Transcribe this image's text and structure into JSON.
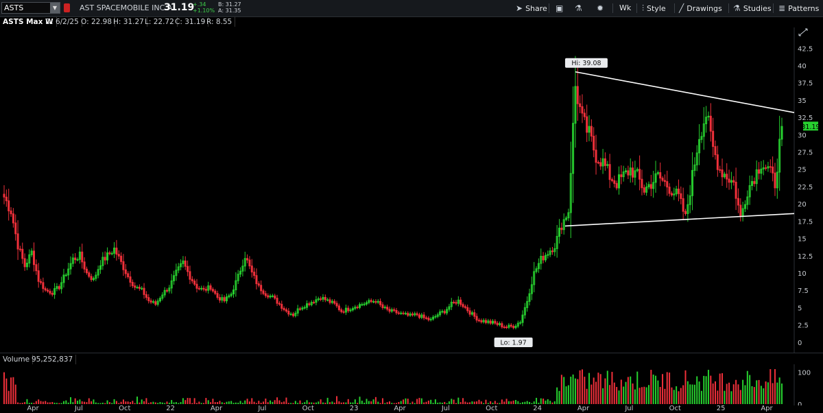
{
  "header": {
    "symbol": "ASTS",
    "company": "AST SPACEMOBILE INC A",
    "last": "31.19",
    "change": "+.34",
    "change_pct": "+1.10%",
    "bid": "B: 31.27",
    "ask": "A: 31.35"
  },
  "toolbar": {
    "share": "Share",
    "wk": "Wk",
    "style": "Style",
    "drawings": "Drawings",
    "studies": "Studies",
    "patterns": "Patterns"
  },
  "infobar": {
    "title": "ASTS Max W",
    "date": "D: 6/2/25",
    "open": "O: 22.98",
    "high": "H: 31.27",
    "low": "L: 22.72",
    "close": "C: 31.19",
    "range": "R: 8.55"
  },
  "volume_header": {
    "label": "Volume",
    "value": "95,252,837"
  },
  "colors": {
    "up": "#27d02f",
    "down": "#f0303a",
    "background": "#000000",
    "toolbar": "#16191d"
  },
  "chart_data": {
    "type": "candlestick",
    "interval": "weekly",
    "y_axis": {
      "ticks": [
        "0",
        "2.5",
        "5",
        "7.5",
        "10",
        "12.5",
        "15",
        "17.5",
        "20",
        "22.5",
        "25",
        "27.5",
        "30",
        "32.5",
        "35",
        "37.5",
        "40",
        "42.5"
      ],
      "range": [
        -1.5,
        45.5
      ]
    },
    "x_axis": {
      "labels": [
        "Apr",
        "Jul",
        "Oct",
        "22",
        "Apr",
        "Jul",
        "Oct",
        "23",
        "Apr",
        "Jul",
        "Oct",
        "24",
        "Apr",
        "Jul",
        "Oct",
        "25",
        "Apr"
      ]
    },
    "last_price_label": "31.19",
    "annotations": [
      {
        "text": "Hi: 39.08",
        "value": 39.08
      },
      {
        "text": "Lo: 1.97",
        "value": 1.97
      }
    ],
    "trendlines": [
      {
        "name": "upper",
        "from": 39.08,
        "to": 33.2
      },
      {
        "name": "lower",
        "from": 16.8,
        "to": 18.6
      }
    ],
    "close_anchors": [
      21,
      19,
      14,
      11,
      13,
      9,
      7.5,
      7.2,
      8,
      10,
      12,
      12.5,
      10,
      9,
      11.5,
      12.5,
      13.5,
      11.5,
      9.5,
      8,
      7.5,
      6,
      5.5,
      7,
      8,
      10,
      11.5,
      9.5,
      8,
      7.5,
      8,
      6.5,
      6,
      7,
      9.5,
      12.5,
      10,
      8,
      7,
      6.5,
      5.5,
      4.5,
      4,
      5,
      5.5,
      6,
      6.5,
      6,
      5.5,
      4.5,
      4.8,
      5.2,
      5.5,
      5.8,
      6,
      5,
      4.5,
      4.3,
      4,
      3.8,
      4,
      3.5,
      3.2,
      4,
      4.5,
      5.5,
      6,
      5,
      4,
      3.2,
      3,
      2.8,
      2.5,
      2.2,
      2.3,
      3,
      6,
      10,
      12,
      13,
      14,
      17,
      19,
      37,
      32,
      30,
      27,
      26,
      24,
      23,
      24,
      25,
      24,
      22,
      23,
      24,
      23,
      22,
      21,
      18,
      24,
      30,
      33,
      28,
      25,
      24,
      23,
      18,
      22,
      24,
      26,
      25,
      23,
      31.2
    ],
    "volume_axis": {
      "ticks": [
        "0",
        "100"
      ],
      "range": [
        0,
        120
      ]
    }
  }
}
